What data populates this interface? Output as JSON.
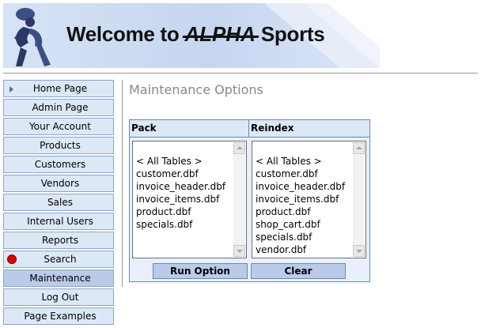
{
  "banner": {
    "title_prefix": "Welcome to",
    "brand": "ALPHA",
    "title_suffix": "Sports"
  },
  "sidebar": {
    "items": [
      {
        "label": "Home Page",
        "icon": "arrow-right-icon"
      },
      {
        "label": "Admin Page"
      },
      {
        "label": "Your Account"
      },
      {
        "label": "Products"
      },
      {
        "label": "Customers"
      },
      {
        "label": "Vendors"
      },
      {
        "label": "Sales"
      },
      {
        "label": "Internal Users"
      },
      {
        "label": "Reports"
      },
      {
        "label": "Search",
        "icon": "red-dot-icon"
      },
      {
        "label": "Maintenance",
        "active": true
      },
      {
        "label": "Log Out"
      },
      {
        "label": "Page Examples"
      }
    ]
  },
  "main": {
    "title": "Maintenance Options",
    "pack": {
      "header": "Pack",
      "items": [
        "< All Tables >",
        "customer.dbf",
        "invoice_header.dbf",
        "invoice_items.dbf",
        "product.dbf",
        "specials.dbf"
      ]
    },
    "reindex": {
      "header": "Reindex",
      "items": [
        "< All Tables >",
        "customer.dbf",
        "invoice_header.dbf",
        "invoice_items.dbf",
        "product.dbf",
        "shop_cart.dbf",
        "specials.dbf",
        "vendor.dbf"
      ]
    },
    "run_label": "Run Option",
    "clear_label": "Clear"
  },
  "colors": {
    "nav_bg": "#dde8f7",
    "nav_active": "#b9cbe9",
    "border": "#8ea4c6",
    "title": "#888888"
  }
}
